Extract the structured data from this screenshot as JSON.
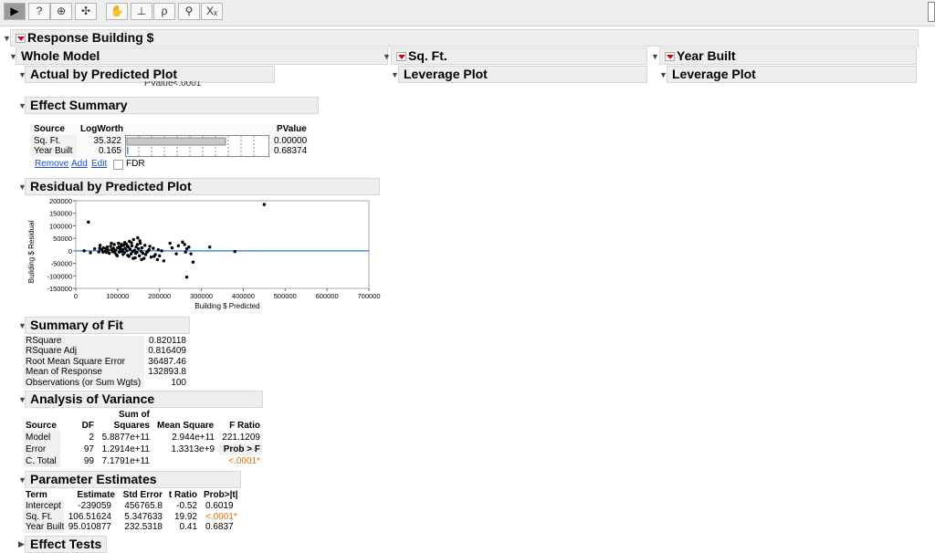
{
  "toolbar": {
    "tools": [
      "arrow-tool",
      "help-tool",
      "crosshair-tool",
      "move-tool",
      "grabber-tool",
      "brush-tool",
      "lasso-tool",
      "magnifier-tool",
      "annotate-tool"
    ],
    "glyphs": [
      "▶",
      "?",
      "⊕",
      "✣",
      "✋",
      "⊥",
      "ρ",
      "⚲",
      "Xₓ"
    ]
  },
  "report": {
    "title": "Response Building $",
    "whole_model": "Whole Model",
    "actual_by_predicted": "Actual by Predicted Plot",
    "clipped_text": "PValue<.0001",
    "sqft_header": "Sq. Ft.",
    "yearbuilt_header": "Year Built",
    "leverage_plot": "Leverage Plot"
  },
  "effect_summary": {
    "title": "Effect Summary",
    "headers": {
      "source": "Source",
      "logworth": "LogWorth",
      "pvalue": "PValue"
    },
    "rows": [
      {
        "source": "Sq. Ft.",
        "logworth": "35.322",
        "pvalue": "0.00000",
        "bar_fraction": 1.0
      },
      {
        "source": "Year Built",
        "logworth": "0.165",
        "pvalue": "0.68374",
        "bar_fraction": 0.005
      }
    ],
    "links": {
      "remove": "Remove",
      "add": "Add",
      "edit": "Edit"
    },
    "fdr_label": "FDR"
  },
  "residual_plot": {
    "title": "Residual by Predicted Plot",
    "ylabel": "Building $ Residual",
    "xlabel": "Building $ Predicted"
  },
  "chart_data": {
    "type": "scatter",
    "title": "",
    "xlabel": "Building $ Predicted",
    "ylabel": "Building $ Residual",
    "xlim": [
      0,
      700000
    ],
    "ylim": [
      -150000,
      200000
    ],
    "x_ticks": [
      "0",
      "100000",
      "200000",
      "300000",
      "400000",
      "500000",
      "600000",
      "700000"
    ],
    "y_ticks": [
      "200000",
      "150000",
      "100000",
      "50000",
      "0",
      "-50000",
      "-100000",
      "-150000"
    ],
    "x_tick_values": [
      0,
      100000,
      200000,
      300000,
      400000,
      500000,
      600000,
      700000
    ],
    "y_tick_values": [
      200000,
      150000,
      100000,
      50000,
      0,
      -50000,
      -100000,
      -150000
    ],
    "reference_line_y": 0,
    "reference_color": "#4a90e2",
    "points": [
      [
        450000,
        185000
      ],
      [
        30000,
        115000
      ],
      [
        20000,
        0
      ],
      [
        35000,
        -8000
      ],
      [
        45000,
        8000
      ],
      [
        55000,
        -4000
      ],
      [
        58000,
        22000
      ],
      [
        62000,
        5000
      ],
      [
        66000,
        12000
      ],
      [
        70000,
        -2000
      ],
      [
        72000,
        8000
      ],
      [
        75000,
        15000
      ],
      [
        78000,
        3000
      ],
      [
        80000,
        -10000
      ],
      [
        83000,
        18000
      ],
      [
        86000,
        6000
      ],
      [
        88000,
        -3000
      ],
      [
        90000,
        10000
      ],
      [
        92000,
        25000
      ],
      [
        95000,
        2000
      ],
      [
        97000,
        -15000
      ],
      [
        100000,
        12000
      ],
      [
        102000,
        30000
      ],
      [
        104000,
        -5000
      ],
      [
        106000,
        8000
      ],
      [
        108000,
        18000
      ],
      [
        110000,
        -2000
      ],
      [
        112000,
        4000
      ],
      [
        114000,
        22000
      ],
      [
        116000,
        -8000
      ],
      [
        118000,
        10000
      ],
      [
        120000,
        28000
      ],
      [
        122000,
        0
      ],
      [
        124000,
        -18000
      ],
      [
        126000,
        14000
      ],
      [
        128000,
        38000
      ],
      [
        130000,
        6000
      ],
      [
        132000,
        -12000
      ],
      [
        134000,
        20000
      ],
      [
        136000,
        -3000
      ],
      [
        138000,
        45000
      ],
      [
        140000,
        2000
      ],
      [
        142000,
        -28000
      ],
      [
        144000,
        15000
      ],
      [
        146000,
        -6000
      ],
      [
        148000,
        52000
      ],
      [
        150000,
        8000
      ],
      [
        152000,
        -20000
      ],
      [
        154000,
        30000
      ],
      [
        156000,
        -2000
      ],
      [
        158000,
        12000
      ],
      [
        160000,
        -10000
      ],
      [
        165000,
        22000
      ],
      [
        170000,
        -5000
      ],
      [
        175000,
        5000
      ],
      [
        180000,
        -25000
      ],
      [
        185000,
        10000
      ],
      [
        190000,
        -15000
      ],
      [
        195000,
        -35000
      ],
      [
        200000,
        -20000
      ],
      [
        205000,
        0
      ],
      [
        210000,
        -40000
      ],
      [
        225000,
        30000
      ],
      [
        230000,
        12000
      ],
      [
        240000,
        -12000
      ],
      [
        245000,
        20000
      ],
      [
        255000,
        35000
      ],
      [
        260000,
        25000
      ],
      [
        262000,
        -5000
      ],
      [
        265000,
        8000
      ],
      [
        270000,
        15000
      ],
      [
        275000,
        -12000
      ],
      [
        280000,
        -45000
      ],
      [
        265000,
        -105000
      ],
      [
        320000,
        15000
      ],
      [
        380000,
        -3000
      ],
      [
        65000,
        -5000
      ],
      [
        85000,
        30000
      ],
      [
        99000,
        -20000
      ],
      [
        109000,
        26000
      ],
      [
        117000,
        33000
      ],
      [
        127000,
        -22000
      ],
      [
        137000,
        -30000
      ],
      [
        147000,
        25000
      ],
      [
        157000,
        -35000
      ],
      [
        167000,
        -15000
      ],
      [
        177000,
        18000
      ],
      [
        187000,
        -22000
      ],
      [
        197000,
        4000
      ],
      [
        57000,
        10000
      ],
      [
        73000,
        -6000
      ],
      [
        93000,
        -7000
      ],
      [
        103000,
        16000
      ],
      [
        113000,
        -14000
      ],
      [
        123000,
        20000
      ],
      [
        133000,
        32000
      ],
      [
        143000,
        -10000
      ],
      [
        153000,
        40000
      ],
      [
        163000,
        -30000
      ],
      [
        173000,
        0
      ]
    ]
  },
  "summary_of_fit": {
    "title": "Summary of Fit",
    "rows": [
      {
        "label": "RSquare",
        "value": "0.820118"
      },
      {
        "label": "RSquare Adj",
        "value": "0.816409"
      },
      {
        "label": "Root Mean Square Error",
        "value": "36487.46"
      },
      {
        "label": "Mean of Response",
        "value": "132893.8"
      },
      {
        "label": "Observations (or Sum Wgts)",
        "value": "100"
      }
    ]
  },
  "anova": {
    "title": "Analysis of Variance",
    "head1": "Sum of",
    "headers": {
      "source": "Source",
      "df": "DF",
      "ss": "Squares",
      "ms": "Mean Square",
      "f": "F Ratio"
    },
    "rows": [
      {
        "source": "Model",
        "df": "2",
        "ss": "5.8877e+11",
        "ms": "2.944e+11",
        "f": "221.1209"
      },
      {
        "source": "Error",
        "df": "97",
        "ss": "1.2914e+11",
        "ms": "1.3313e+9",
        "f": "Prob > F"
      },
      {
        "source": "C. Total",
        "df": "99",
        "ss": "7.1791e+11",
        "ms": "",
        "f": "<.0001*"
      }
    ]
  },
  "parameter_estimates": {
    "title": "Parameter Estimates",
    "headers": {
      "term": "Term",
      "estimate": "Estimate",
      "se": "Std Error",
      "t": "t Ratio",
      "p": "Prob>|t|"
    },
    "rows": [
      {
        "term": "Intercept",
        "estimate": "-239059",
        "se": "456765.8",
        "t": "-0.52",
        "p": "0.6019"
      },
      {
        "term": "Sq. Ft.",
        "estimate": "106.51624",
        "se": "5.347633",
        "t": "19.92",
        "p": "<.0001*"
      },
      {
        "term": "Year Built",
        "estimate": "95.010877",
        "se": "232.5318",
        "t": "0.41",
        "p": "0.6837"
      }
    ]
  },
  "effect_tests": {
    "title": "Effect Tests"
  }
}
